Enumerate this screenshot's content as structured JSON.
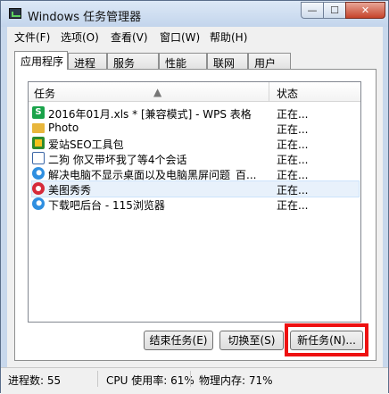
{
  "window": {
    "title": "Windows 任务管理器",
    "controls": {
      "minimize": "—",
      "maximize": "☐",
      "close": "✕"
    }
  },
  "menu": [
    {
      "label": "文件(F)"
    },
    {
      "label": "选项(O)"
    },
    {
      "label": "查看(V)"
    },
    {
      "label": "窗口(W)"
    },
    {
      "label": "帮助(H)"
    }
  ],
  "tabs": [
    {
      "label": "应用程序",
      "active": true
    },
    {
      "label": "进程"
    },
    {
      "label": "服务"
    },
    {
      "label": "性能"
    },
    {
      "label": "联网"
    },
    {
      "label": "用户"
    }
  ],
  "list": {
    "columns": {
      "task": "任务",
      "status": "状态"
    },
    "rows": [
      {
        "icon": "wps-spreadsheet-icon",
        "name": "2016年01月.xls * [兼容模式] - WPS 表格",
        "status": "正在..."
      },
      {
        "icon": "folder-icon",
        "name": "Photo",
        "status": "正在..."
      },
      {
        "icon": "seo-toolkit-icon",
        "name": "爱站SEO工具包",
        "status": "正在..."
      },
      {
        "icon": "chat-icon",
        "name": "二狗 你又带坏我了等4个会话",
        "status": "正在..."
      },
      {
        "icon": "browser-icon",
        "name": "解决电脑不显示桌面以及电脑黑屏问题_百...",
        "status": "正在..."
      },
      {
        "icon": "meitu-icon",
        "name": "美图秀秀",
        "status": "正在..."
      },
      {
        "icon": "browser-icon",
        "name": "下载吧后台 - 115浏览器",
        "status": "正在..."
      }
    ]
  },
  "buttons": {
    "end_task": "结束任务(E)",
    "switch_to": "切换至(S)",
    "new_task": "新任务(N)..."
  },
  "statusbar": {
    "processes": "进程数: 55",
    "cpu": "CPU 使用率: 61%",
    "memory": "物理内存: 71%"
  },
  "colors": {
    "highlight": "#ee1111",
    "title_bg": "#c8d8ec",
    "close_button": "#c6442b"
  }
}
